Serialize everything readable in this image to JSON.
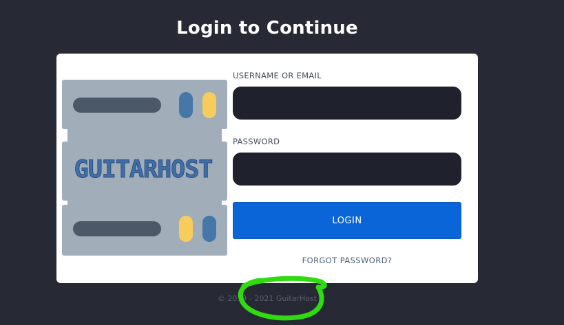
{
  "page": {
    "title": "Login to Continue"
  },
  "logo": {
    "text": "GUITARHOST",
    "colors": {
      "body": "#a2adba",
      "slot": "#4a5868",
      "blue_led": "#4577a8",
      "yellow_led": "#f6cd5a",
      "text": "#3f6fa6"
    }
  },
  "form": {
    "username_label": "USERNAME OR EMAIL",
    "username_value": "",
    "password_label": "PASSWORD",
    "password_value": "",
    "login_label": "LOGIN",
    "forgot_label": "FORGOT PASSWORD?"
  },
  "footer": {
    "text": "© 2019 - 2021 GuitarHost"
  },
  "annotation": {
    "color": "#2fdc0f"
  },
  "colors": {
    "background": "#272a35",
    "card": "#ffffff",
    "input": "#1f222c",
    "button": "#0a66d8"
  }
}
